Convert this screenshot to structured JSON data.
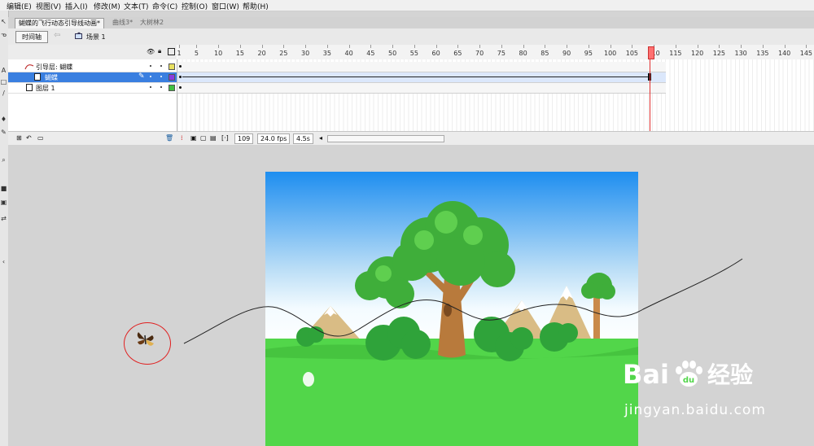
{
  "menu": {
    "items": [
      "编辑(E)",
      "视图(V)",
      "插入(I)",
      "修改(M)",
      "文本(T)",
      "命令(C)",
      "控制(O)",
      "窗口(W)",
      "帮助(H)"
    ]
  },
  "tabs": [
    {
      "label": "蝴蝶的飞行动态引导线动画*",
      "active": true
    },
    {
      "label": "曲线3*",
      "active": false
    },
    {
      "label": "大树林2",
      "active": false
    }
  ],
  "editbar": {
    "timeline_button": "时间轴",
    "scene_label": "场景 1"
  },
  "timeline": {
    "ruler_labels": [
      "1",
      "5",
      "10",
      "15",
      "20",
      "25",
      "30",
      "35",
      "40",
      "45",
      "50",
      "55",
      "60",
      "65",
      "70",
      "75",
      "80",
      "85",
      "90",
      "95",
      "100",
      "105",
      "110",
      "115",
      "120",
      "125",
      "130",
      "135",
      "140",
      "145"
    ],
    "layers": [
      {
        "name": "引导层: 蝴蝶",
        "type": "guide",
        "selected": false,
        "color": "#e8e060"
      },
      {
        "name": "蝴蝶",
        "type": "guided",
        "selected": true,
        "color": "#8a3ae0"
      },
      {
        "name": "图层 1",
        "type": "normal",
        "selected": false,
        "color": "#40c040"
      }
    ],
    "current_frame": "109",
    "fps": "24.0 fps",
    "time": "4.5s"
  },
  "colors": {
    "accent": "#3a7fe0",
    "playhead": "#e03030",
    "sky_top": "#1e8ef0",
    "grass": "#52d64a",
    "annotation": "#e02020"
  },
  "watermark": {
    "brand": "Bai",
    "brand_suffix": "经验",
    "url": "jingyan.baidu.com"
  }
}
